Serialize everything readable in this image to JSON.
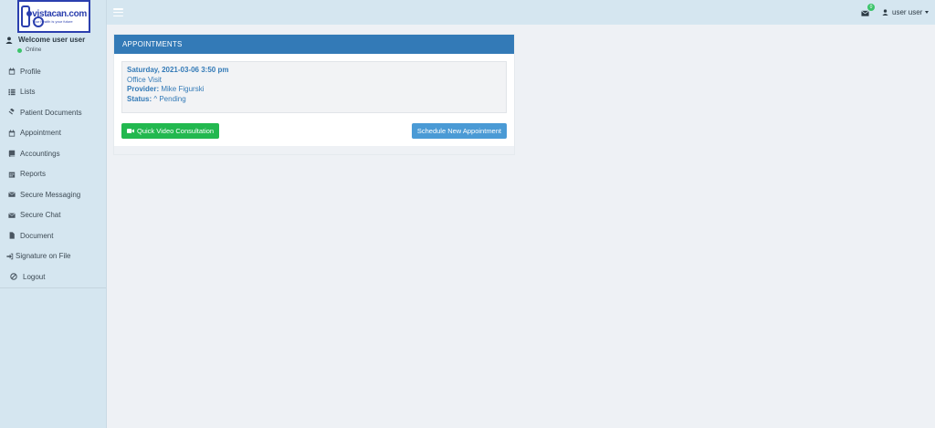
{
  "brand": {
    "logo_name": "vistacan.com",
    "logo_tagline": "Your health is your future"
  },
  "user": {
    "welcome": "Welcome user user",
    "status": "Online"
  },
  "sidebar": {
    "items": [
      {
        "label": "Profile",
        "icon": "calendar-icon"
      },
      {
        "label": "Lists",
        "icon": "list-icon"
      },
      {
        "label": "Patient Documents",
        "icon": "gavel-icon"
      },
      {
        "label": "Appointment",
        "icon": "calendar-icon"
      },
      {
        "label": "Accountings",
        "icon": "book-icon"
      },
      {
        "label": "Reports",
        "icon": "calendar-grid-icon"
      },
      {
        "label": "Secure Messaging",
        "icon": "envelope-icon"
      },
      {
        "label": "Secure Chat",
        "icon": "envelope-icon"
      },
      {
        "label": "Document",
        "icon": "file-icon"
      },
      {
        "label": "Signature on File",
        "icon": "sign-in-icon"
      },
      {
        "label": "Logout",
        "icon": "ban-icon"
      }
    ]
  },
  "topbar": {
    "mail_count": "0",
    "user_name": "user user"
  },
  "appointments": {
    "title": "APPOINTMENTS",
    "entry": {
      "datetime": "Saturday, 2021-03-06 3:50 pm",
      "type": "Office Visit",
      "provider_label": "Provider:",
      "provider": "Mike Figurski",
      "status_label": "Status:",
      "status": "^ Pending"
    },
    "quick_video_label": "Quick Video Consultation",
    "schedule_label": "Schedule New Appointment"
  },
  "colors": {
    "sidebar_bg": "#d5e6f0",
    "panel_header": "#337ab7",
    "green_button": "#22b84f",
    "blue_button": "#4a9ad5",
    "online_dot": "#3cc46a"
  }
}
